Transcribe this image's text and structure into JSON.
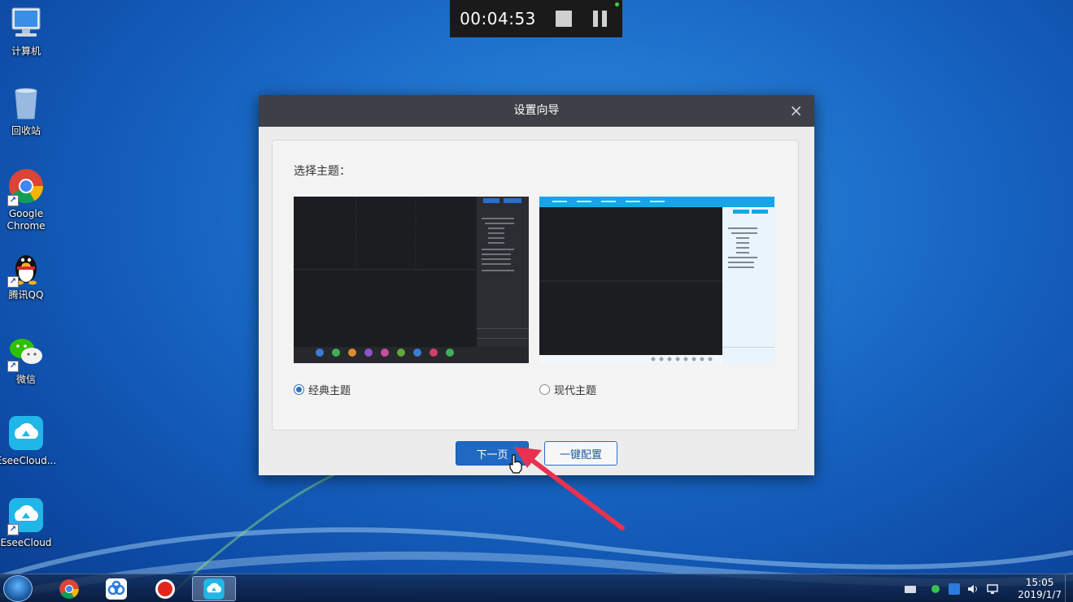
{
  "recorder": {
    "time": "00:04:53"
  },
  "desktop_icons": [
    {
      "label": "计算机"
    },
    {
      "label": "回收站"
    },
    {
      "label": "Google\nChrome"
    },
    {
      "label": "腾讯QQ"
    },
    {
      "label": "微信"
    },
    {
      "label": "EseeCloud..."
    },
    {
      "label": "EseeCloud"
    }
  ],
  "dialog": {
    "title": "设置向导",
    "close_symbol": "×",
    "heading": "选择主题：",
    "themes": [
      {
        "label": "经典主题",
        "selected": true
      },
      {
        "label": "现代主题",
        "selected": false
      }
    ],
    "buttons": {
      "next": "下一页",
      "one_click": "一键配置"
    }
  },
  "taskbar": {
    "clock_time": "15:05",
    "clock_date": "2019/1/7"
  },
  "colors": {
    "dialog_title_bar": "#3d4046",
    "primary_button": "#1f69c2",
    "arrow": "#e8324f"
  }
}
